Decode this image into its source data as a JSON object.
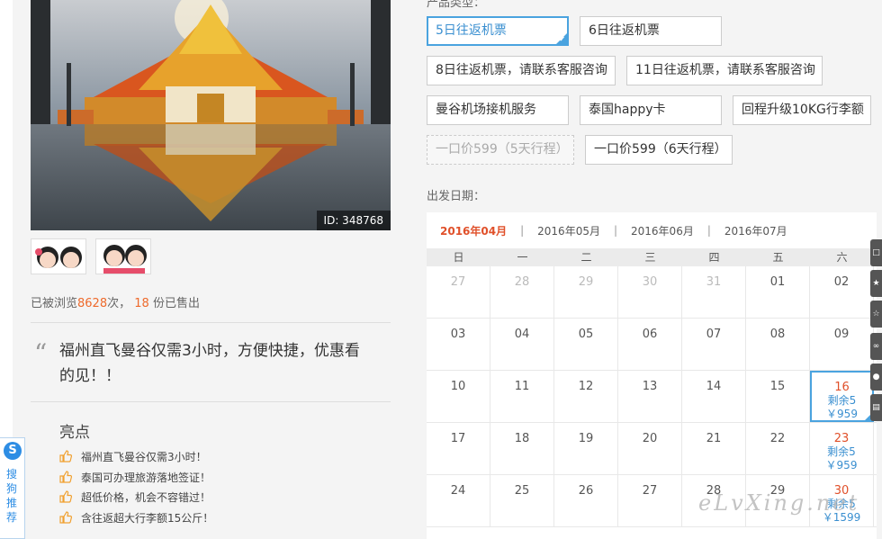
{
  "product": {
    "photo_id": "ID: 348768",
    "stats": {
      "prefix": "已被浏览",
      "views": "8628",
      "mid": "次，",
      "sold": "18",
      "suffix": "份已售出"
    },
    "quote": "福州直飞曼谷仅需3小时，方便快捷，优惠看的见！！",
    "highlights_title": "亮点",
    "highlights": [
      "福州直飞曼谷仅需3小时！",
      "泰国可办理旅游落地签证！",
      "超低价格，机会不容错过！",
      "含往返超大行李额15公斤！"
    ]
  },
  "sogou": {
    "logo": "S",
    "text": "搜狗推荐"
  },
  "options": {
    "label": "产品类型：",
    "items": [
      {
        "label": "5日往返机票"
      },
      {
        "label": "6日往返机票"
      },
      {
        "label": "8日往返机票，请联系客服咨询"
      },
      {
        "label": "11日往返机票，请联系客服咨询"
      },
      {
        "label": "曼谷机场接机服务"
      },
      {
        "label": "泰国happy卡"
      },
      {
        "label": "回程升级10KG行李额"
      },
      {
        "label": "一口价599（5天行程）"
      },
      {
        "label": "一口价599（6天行程）"
      }
    ]
  },
  "calendar": {
    "label": "出发日期：",
    "months": [
      "2016年04月",
      "2016年05月",
      "2016年06月",
      "2016年07月"
    ],
    "separator": "|",
    "weekdays": [
      "日",
      "一",
      "二",
      "三",
      "四",
      "五",
      "六"
    ],
    "rows": [
      [
        {
          "d": "27"
        },
        {
          "d": "28"
        },
        {
          "d": "29"
        },
        {
          "d": "30"
        },
        {
          "d": "31"
        },
        {
          "d": "01"
        },
        {
          "d": "02"
        }
      ],
      [
        {
          "d": "03"
        },
        {
          "d": "04"
        },
        {
          "d": "05"
        },
        {
          "d": "06"
        },
        {
          "d": "07"
        },
        {
          "d": "08"
        },
        {
          "d": "09"
        }
      ],
      [
        {
          "d": "10"
        },
        {
          "d": "11"
        },
        {
          "d": "12"
        },
        {
          "d": "13"
        },
        {
          "d": "14"
        },
        {
          "d": "15"
        },
        {
          "d": "16",
          "s": "剩余5",
          "p": "￥959"
        }
      ],
      [
        {
          "d": "17"
        },
        {
          "d": "18"
        },
        {
          "d": "19"
        },
        {
          "d": "20"
        },
        {
          "d": "21"
        },
        {
          "d": "22"
        },
        {
          "d": "23",
          "s": "剩余5",
          "p": "￥959"
        }
      ],
      [
        {
          "d": "24"
        },
        {
          "d": "25"
        },
        {
          "d": "26"
        },
        {
          "d": "27"
        },
        {
          "d": "28"
        },
        {
          "d": "29"
        },
        {
          "d": "30",
          "s": "剩余5",
          "p": "￥1599"
        }
      ]
    ]
  },
  "watermark": "eLvXing.net",
  "colors": {
    "accent": "#4aa3df",
    "highlight": "#ee6a2c",
    "price_date": "#e0502a"
  }
}
